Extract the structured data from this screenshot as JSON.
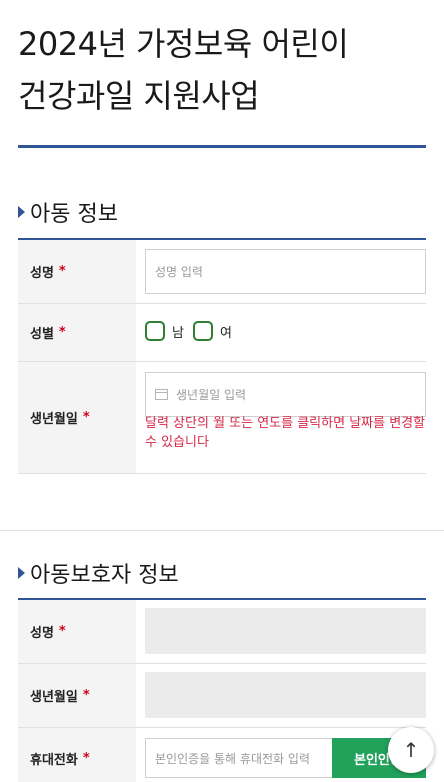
{
  "page": {
    "title_line1": "2024년 가정보육 어린이",
    "title_line2": "건강과일 지원사업"
  },
  "child_section": {
    "heading": "아동 정보",
    "name": {
      "label": "성명",
      "required_mark": "*",
      "placeholder": "성명 입력"
    },
    "gender": {
      "label": "성별",
      "required_mark": "*",
      "options": [
        "남",
        "여"
      ]
    },
    "birth": {
      "label": "생년월일",
      "required_mark": "*",
      "placeholder": "생년월일 입력",
      "hint": "달력 상단의 월 또는 연도를 클릭하면 날짜를 변경할 수 있습니다"
    }
  },
  "guardian_section": {
    "heading": "아동보호자 정보",
    "name": {
      "label": "성명",
      "required_mark": "*"
    },
    "birth": {
      "label": "생년월일",
      "required_mark": "*"
    },
    "phone": {
      "label": "휴대전화",
      "required_mark": "*",
      "placeholder": "본인인증을 통해 휴대전화 입력",
      "auth_button": "본인인증"
    }
  },
  "scroll_top": {
    "icon": "arrow-up-icon",
    "glyph": "↑"
  },
  "colors": {
    "accent": "#2f5597",
    "required": "#d0021b",
    "hint": "#d62947",
    "checkbox": "#2e7d32",
    "auth_button": "#22a15a"
  }
}
